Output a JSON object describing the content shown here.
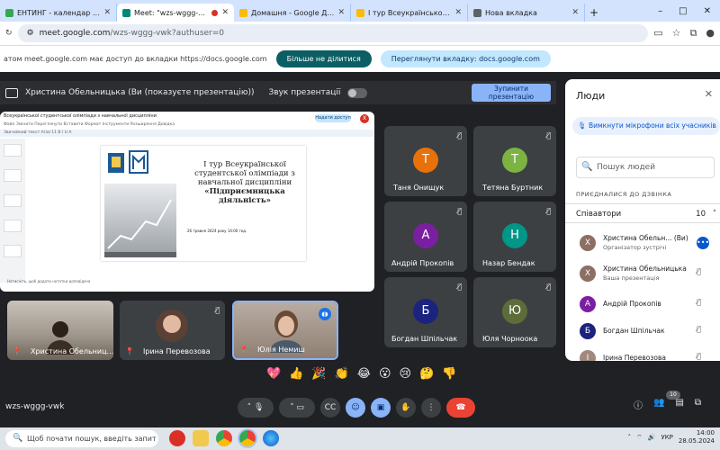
{
  "browser": {
    "tabs": [
      {
        "title": "ЕНТИНГ - календар - Депар",
        "color": "#34a853",
        "active": false
      },
      {
        "title": "Meet: \"wzs-wggg-vwk\"",
        "color": "#00897b",
        "active": true,
        "recording": true
      },
      {
        "title": "Домашня - Google Диск",
        "color": "#fbbc04",
        "active": false
      },
      {
        "title": "I тур Всеукраїнської студе",
        "color": "#fbbc04",
        "active": false
      },
      {
        "title": "Нова вкладка",
        "color": "#5f6368",
        "active": false
      }
    ],
    "new_tab": "+",
    "window_controls": [
      "–",
      "□",
      "✕"
    ],
    "url_host": "meet.google.com",
    "url_path": "/wzs-wggg-vwk?authuser=0"
  },
  "share_notice": {
    "text": "атом meet.google.com має доступ до вкладки https://docs.google.com",
    "stop_label": "Більше не ділитися",
    "switch_label": "Переглянути вкладку: docs.google.com"
  },
  "presentation_bar": {
    "title": "Христина Обельницька (Ви (показуєте презентацію))",
    "sound_label": "Звук презентації",
    "stop_label": "Зупинити презентацію"
  },
  "preview": {
    "doc_title": "Всеукраїнської студентської олімпіади з навчальної дисципліни",
    "menu": "Файл  Змінити  Переглянути  Вставити  Формат  Інструменти  Розширення  Довідка",
    "toolbar": "Звичайний текст   Arial   11   B  I  U  A",
    "share_label": "Надати доступ",
    "avatar_letter": "Х",
    "heading": [
      "I тур Всеукраїнської",
      "студентської олімпіади з",
      "навчальної дисципліни"
    ],
    "heading_bold": "«Підприємницька діяльність»",
    "date": "26 травня 2024 року 14:00 год.",
    "footer_note": "Натисніть, щоб додати нотатки доповідача"
  },
  "tiles": [
    {
      "name": "Таня Онищук",
      "letter": "Т",
      "color": "#e8710a"
    },
    {
      "name": "Тетяна Буртник",
      "letter": "Т",
      "color": "#7cb342"
    },
    {
      "name": "Андрій Прокопів",
      "letter": "А",
      "color": "#7b1fa2"
    },
    {
      "name": "Назар Бендак",
      "letter": "Н",
      "color": "#009688"
    },
    {
      "name": "Богдан Шпільчак",
      "letter": "Б",
      "color": "#1a237e"
    },
    {
      "name": "Юля Чорноока",
      "letter": "Ю",
      "color": "#5d6d3a"
    },
    {
      "name": "Христина Обельниц...",
      "letter": "Х",
      "color": "#8d6e63"
    },
    {
      "name": "Ірина Перевозова",
      "letter": "І",
      "color": "#a1887f"
    },
    {
      "name": "Юлія Немиш",
      "letter": "Ю",
      "color": "#6d4c41"
    }
  ],
  "people_panel": {
    "title": "Люди",
    "mute_all": "Вимкнути мікрофони всіх учасників",
    "search_placeholder": "Пошук людей",
    "section": "ПРИЄДНАЛИСЯ ДО ДЗВІНКА",
    "group": "Співавтори",
    "count": "10",
    "people": [
      {
        "name": "Христина Обельн... (Ви)",
        "sub": "Організатор зустрічі",
        "letter": "Х",
        "color": "#8d6e63"
      },
      {
        "name": "Христина Обельницька",
        "sub": "Ваша презентація",
        "letter": "Х",
        "color": "#8d6e63"
      },
      {
        "name": "Андрій Прокопів",
        "sub": "",
        "letter": "А",
        "color": "#7b1fa2"
      },
      {
        "name": "Богдан Шпільчак",
        "sub": "",
        "letter": "Б",
        "color": "#1a237e"
      },
      {
        "name": "Ірина Перевозова",
        "sub": "",
        "letter": "І",
        "color": "#a1887f"
      }
    ]
  },
  "reactions": [
    "💖",
    "👍",
    "🎉",
    "👏",
    "😂",
    "😮",
    "😢",
    "🤔",
    "👎"
  ],
  "meeting_code": "wzs-wggg-vwk",
  "participants_badge": "10",
  "taskbar": {
    "search_placeholder": "Щоб почати пошук, введіть запит тут",
    "lang": "УКР",
    "time": "14:00",
    "date": "28.05.2024"
  }
}
